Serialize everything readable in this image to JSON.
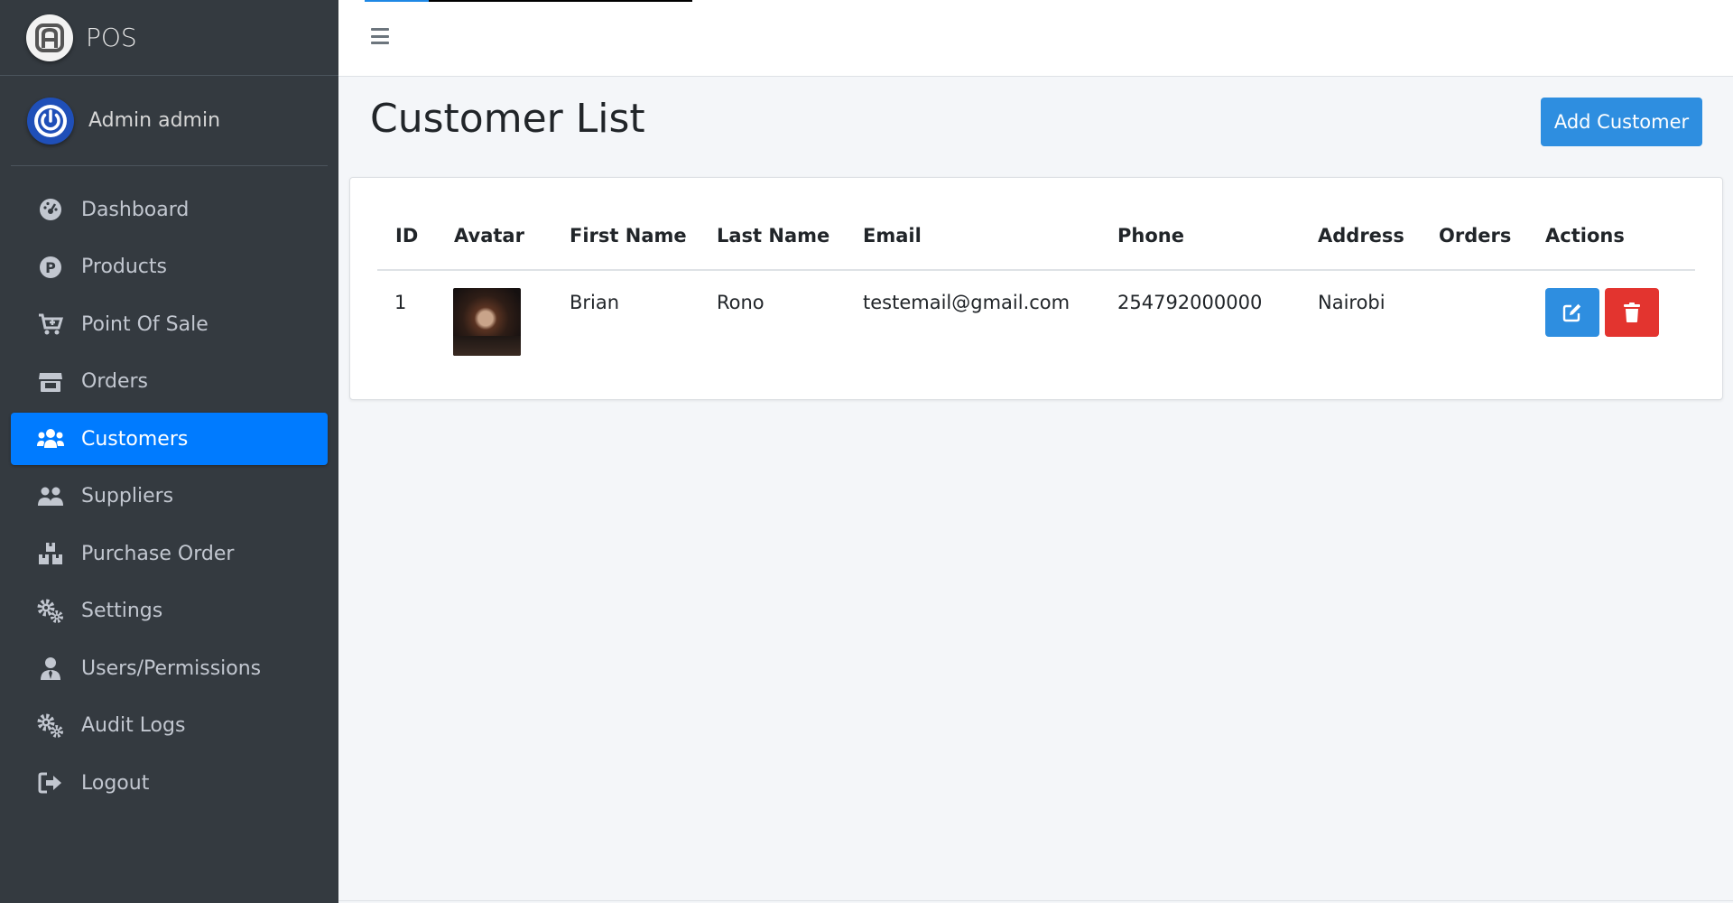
{
  "brand": {
    "name": "POS"
  },
  "user": {
    "name": "Admin admin"
  },
  "sidebar": {
    "items": [
      {
        "label": "Dashboard",
        "icon": "dashboard-gauge-icon"
      },
      {
        "label": "Products",
        "icon": "products-p-circle-icon"
      },
      {
        "label": "Point Of Sale",
        "icon": "cart-plus-icon"
      },
      {
        "label": "Orders",
        "icon": "store-icon"
      },
      {
        "label": "Customers",
        "icon": "users-icon",
        "active": true
      },
      {
        "label": "Suppliers",
        "icon": "user-group-icon"
      },
      {
        "label": "Purchase Order",
        "icon": "boxes-icon"
      },
      {
        "label": "Settings",
        "icon": "cogs-icon"
      },
      {
        "label": "Users/Permissions",
        "icon": "user-tie-icon"
      },
      {
        "label": "Audit Logs",
        "icon": "cogs-icon"
      },
      {
        "label": "Logout",
        "icon": "sign-out-icon"
      }
    ]
  },
  "page": {
    "title": "Customer List",
    "add_button": "Add Customer"
  },
  "table": {
    "headers": [
      "ID",
      "Avatar",
      "First Name",
      "Last Name",
      "Email",
      "Phone",
      "Address",
      "Orders",
      "Actions"
    ],
    "rows": [
      {
        "id": "1",
        "first_name": "Brian",
        "last_name": "Rono",
        "email": "testemail@gmail.com",
        "phone": "254792000000",
        "address": "Nairobi",
        "orders": ""
      }
    ]
  },
  "colors": {
    "sidebar_bg": "#343a40",
    "active": "#007bff",
    "primary_button": "#2e8ee0",
    "danger_button": "#e3342f",
    "content_bg": "#f4f6f9"
  }
}
